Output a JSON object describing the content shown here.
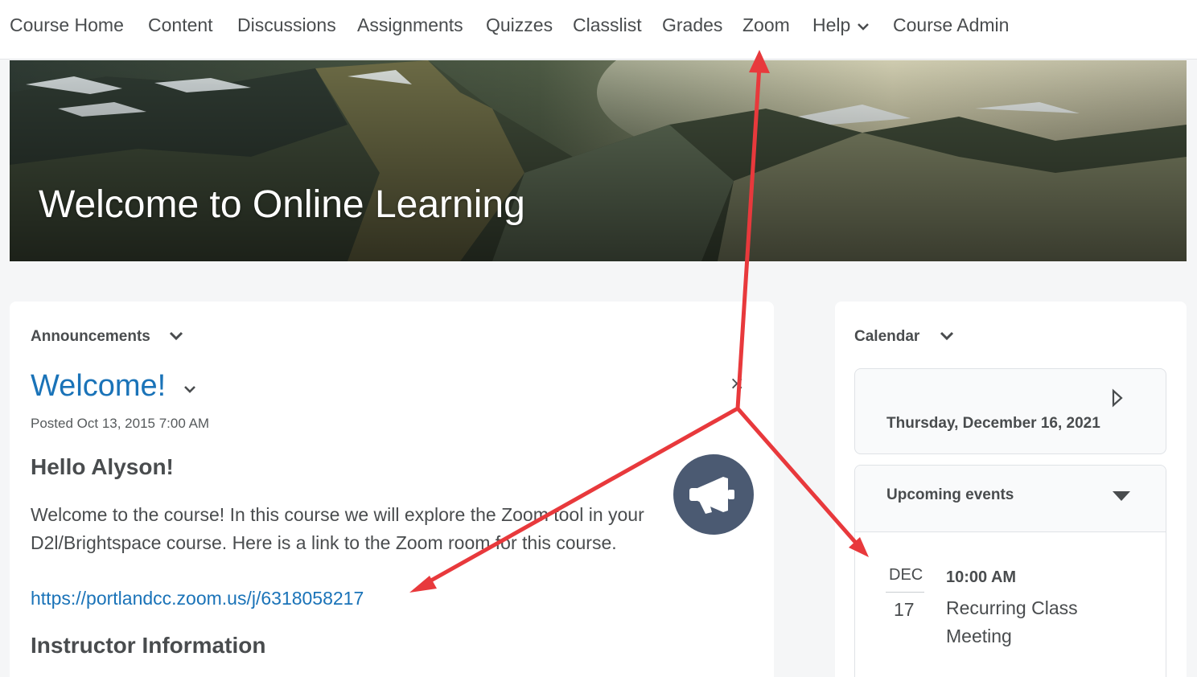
{
  "nav": {
    "items": [
      {
        "label": "Course Home"
      },
      {
        "label": "Content"
      },
      {
        "label": "Discussions"
      },
      {
        "label": "Assignments"
      },
      {
        "label": "Quizzes"
      },
      {
        "label": "Classlist"
      },
      {
        "label": "Grades"
      },
      {
        "label": "Zoom"
      },
      {
        "label": "Help"
      },
      {
        "label": "Course Admin"
      }
    ]
  },
  "banner": {
    "title": "Welcome to Online Learning"
  },
  "announcements": {
    "widget_title": "Announcements",
    "post_title": "Welcome!",
    "posted": "Posted Oct 13, 2015 7:00 AM",
    "greeting": "Hello Alyson!",
    "body": "Welcome to the course! In this course we will explore the Zoom tool in your D2l/Brightspace course. Here is a link to the Zoom room for this course.",
    "link": "https://portlandcc.zoom.us/j/6318058217",
    "section_heading": "Instructor Information",
    "dismiss_symbol": "×",
    "icon": "megaphone-icon"
  },
  "calendar": {
    "widget_title": "Calendar",
    "current_date": "Thursday, December 16, 2021",
    "upcoming_title": "Upcoming events",
    "events": [
      {
        "month": "DEC",
        "day": "17",
        "time": "10:00 AM",
        "title": "Recurring Class Meeting"
      }
    ]
  },
  "colors": {
    "link": "#1a73b8",
    "text": "#494c4e",
    "annotation_arrow": "#e8393c",
    "megaphone_bg": "#4b5a72",
    "page_bg": "#f5f6f7"
  }
}
